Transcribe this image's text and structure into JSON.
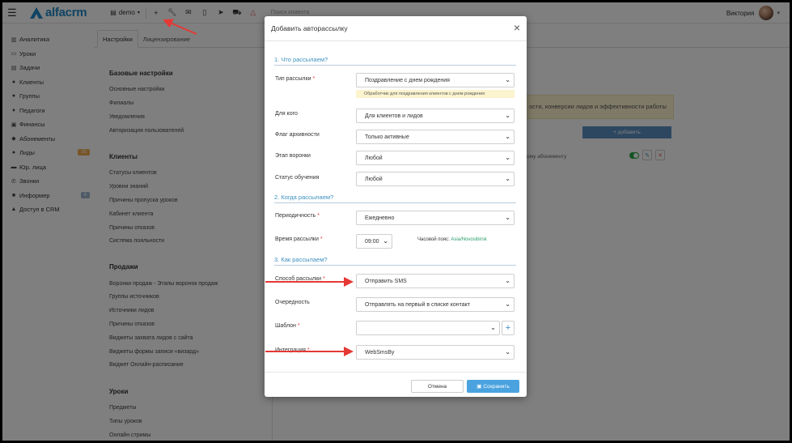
{
  "topbar": {
    "logo_text": "alfacrm",
    "company_label": "demo",
    "search_placeholder": "Поиск клиента",
    "user_name": "Виктория",
    "icons": [
      "menu-icon",
      "building-icon",
      "plus-icon",
      "wrench-icon",
      "mail-icon",
      "mobile-icon",
      "telegram-icon",
      "cart-icon",
      "bell-icon"
    ]
  },
  "sidebar": {
    "items": [
      {
        "label": "Аналитика",
        "icon": "chart-icon"
      },
      {
        "label": "Уроки",
        "icon": "calendar-icon"
      },
      {
        "label": "Задачи",
        "icon": "tasks-icon"
      },
      {
        "label": "Клиенты",
        "icon": "user-icon"
      },
      {
        "label": "Группы",
        "icon": "users-icon"
      },
      {
        "label": "Педагоги",
        "icon": "graduation-icon"
      },
      {
        "label": "Финансы",
        "icon": "money-icon"
      },
      {
        "label": "Абонементы",
        "icon": "tag-icon"
      },
      {
        "label": "Лиды",
        "icon": "user-plus-icon",
        "badge": "25"
      },
      {
        "label": "Юр. лица",
        "icon": "building-icon"
      },
      {
        "label": "Звонки",
        "icon": "phone-icon"
      },
      {
        "label": "Информер",
        "icon": "informer-icon",
        "badge": "9"
      },
      {
        "label": "Доступ в CRM",
        "icon": "lock-icon"
      }
    ]
  },
  "main": {
    "tabs": [
      "Настройки",
      "Лицензирование"
    ],
    "sections": [
      {
        "title": "Базовые настройки",
        "links": [
          "Основные настройки",
          "Филиалы",
          "Уведомления",
          "Авторизация пользователей"
        ]
      },
      {
        "title": "Клиенты",
        "links": [
          "Статусы клиентов",
          "Уровни знаний",
          "Причины пропуска уроков",
          "Кабинет клиента",
          "Причины отказов",
          "Система лояльности"
        ]
      },
      {
        "title": "Продажи",
        "links": [
          "Воронки продаж - Этапы воронок продаж",
          "Группы источников",
          "Источники лидов",
          "Причины отказов",
          "Виджеты захвата лидов с сайта",
          "Виджеты формы записи «визард»",
          "Виджет Онлайн-расписание"
        ]
      },
      {
        "title": "Уроки",
        "links": [
          "Предметы",
          "Типы уроков",
          "Онлайн стримы"
        ]
      }
    ],
    "notice_text": "ости, конверсии лидов и эффективности работы",
    "add_button": "+ добавить",
    "row_text": "ому абонементу"
  },
  "modal": {
    "title": "Добавить авторассылку",
    "section1": "1. Что рассылаем?",
    "section2": "2. Когда рассылаем?",
    "section3": "3. Как рассылаем?",
    "fields": {
      "type": {
        "label": "Тип рассылки",
        "value": "Поздравление с днем рождения",
        "hint": "Обработчик для поздравления клиентов с днем рождения"
      },
      "for_whom": {
        "label": "Для кого",
        "value": "Для клиентов и лидов"
      },
      "archive": {
        "label": "Флаг архивности",
        "value": "Только активные"
      },
      "funnel": {
        "label": "Этап воронки",
        "value": "Любой"
      },
      "study": {
        "label": "Статус обучения",
        "value": "Любой"
      },
      "period": {
        "label": "Периодичность",
        "value": "Ежедневно"
      },
      "time": {
        "label": "Время рассылки",
        "value": "09:00",
        "tz_label": "Часовой пояс:",
        "tz_value": "Asia/Novosibirsk"
      },
      "method": {
        "label": "Способ рассылки",
        "value": "Отправить SMS"
      },
      "order": {
        "label": "Очередность",
        "value": "Отправлять на первый в списке контакт"
      },
      "template": {
        "label": "Шаблон",
        "value": ""
      },
      "integration": {
        "label": "Интеграция",
        "value": "WebSmsBy"
      }
    },
    "cancel_label": "Отмена",
    "save_label": "Сохранить"
  },
  "colors": {
    "accent": "#4aa3df",
    "section": "#3a8fbf",
    "arrow": "#e53935",
    "toggle": "#27a844"
  }
}
